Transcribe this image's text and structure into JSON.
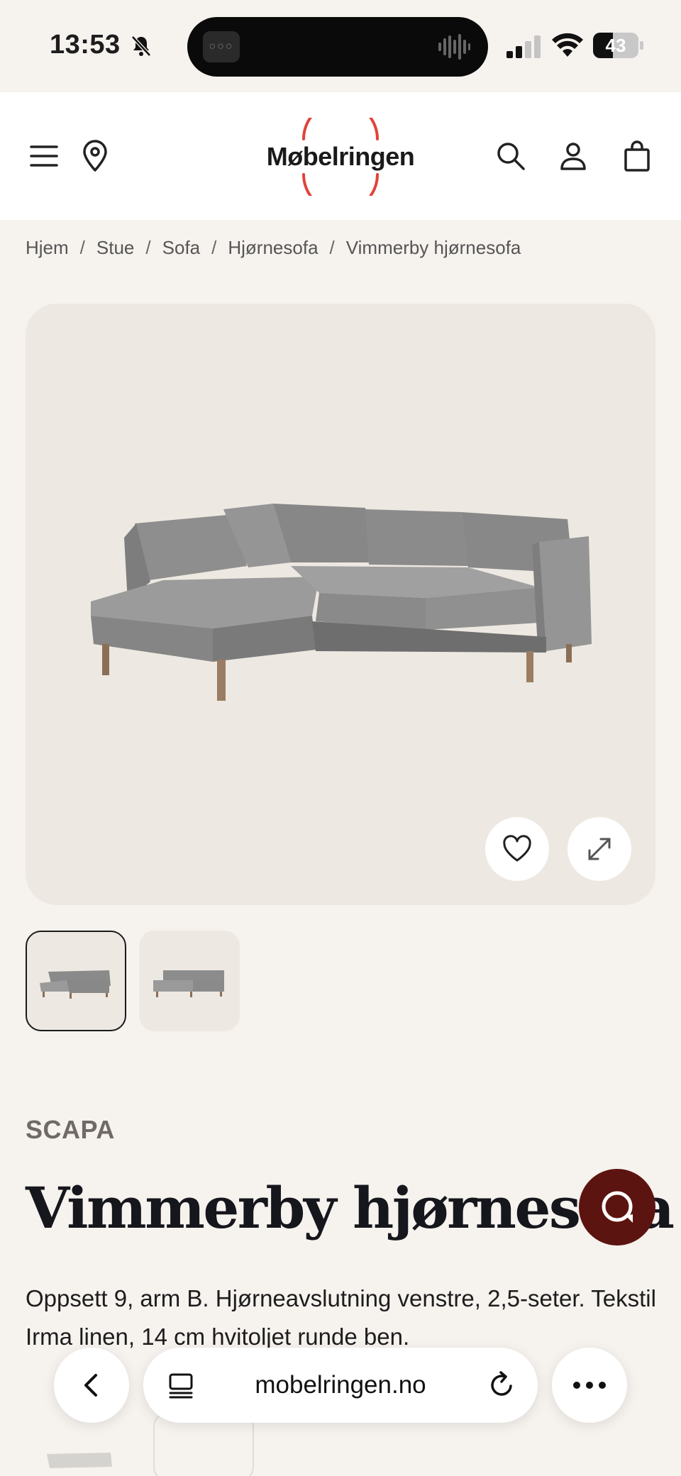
{
  "status_bar": {
    "time": "13:53",
    "battery_percent": "43",
    "battery_level": 0.43
  },
  "header": {
    "logo_text": "Møbelringen",
    "logo_accent_color": "#e0433a",
    "icons": [
      "menu-icon",
      "location-pin-icon",
      "search-icon",
      "account-icon",
      "cart-icon"
    ]
  },
  "breadcrumb": [
    "Hjem",
    "Stue",
    "Sofa",
    "Hjørnesofa",
    "Vimmerby hjørnesofa"
  ],
  "breadcrumb_separator": "/",
  "gallery": {
    "image_count": 2,
    "active_index": 0,
    "buttons": [
      "heart-icon",
      "expand-icon"
    ]
  },
  "product": {
    "brand": "SCAPA",
    "title": "Vimmerby hjørnesofa",
    "description": "Oppsett 9, arm B. Hjørneavslutning venstre, 2,5-seter. Tekstil Irma linen, 14 cm hvitoljet runde ben."
  },
  "chat": {
    "icon": "chat-icon",
    "color": "#5c1410"
  },
  "browser": {
    "url": "mobelringen.no",
    "icons": [
      "back-icon",
      "tabs-icon",
      "reload-icon",
      "more-icon"
    ]
  }
}
